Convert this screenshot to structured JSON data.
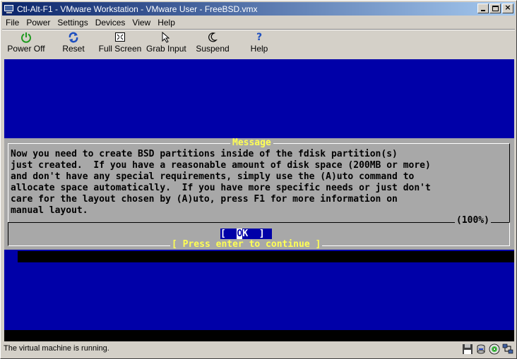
{
  "window": {
    "title": "Ctl-Alt-F1 - VMware Workstation - VMware User - FreeBSD.vmx",
    "minimize_label": "_",
    "close_label": "×"
  },
  "menu": [
    {
      "label": "File"
    },
    {
      "label": "Power"
    },
    {
      "label": "Settings"
    },
    {
      "label": "Devices"
    },
    {
      "label": "View"
    },
    {
      "label": "Help"
    }
  ],
  "toolbar": {
    "power_off": "Power Off",
    "reset": "Reset",
    "full_screen": "Full Screen",
    "grab_input": "Grab Input",
    "suspend": "Suspend",
    "help": "Help"
  },
  "dialog": {
    "title": "Message",
    "body": "Now you need to create BSD partitions inside of the fdisk partition(s)\njust created.  If you have a reasonable amount of disk space (200MB or more)\nand don't have any special requirements, simply use the (A)uto command to\nallocate space automatically.  If you have more specific needs or just don't\ncare for the layout chosen by (A)uto, press F1 for more information on\nmanual layout.",
    "percent": "(100%)",
    "ok_left": "[  ",
    "ok_cursor": "O",
    "ok_right": "K  ]",
    "press_enter": "[ Press enter to continue ]"
  },
  "status": {
    "text": "The virtual machine is running."
  },
  "colors": {
    "vm_background": "#0000a8",
    "dialog_gray": "#a8a8a8",
    "dialog_title": "#ffff54",
    "titlebar_start": "#0a246a",
    "titlebar_end": "#a6caf0"
  }
}
